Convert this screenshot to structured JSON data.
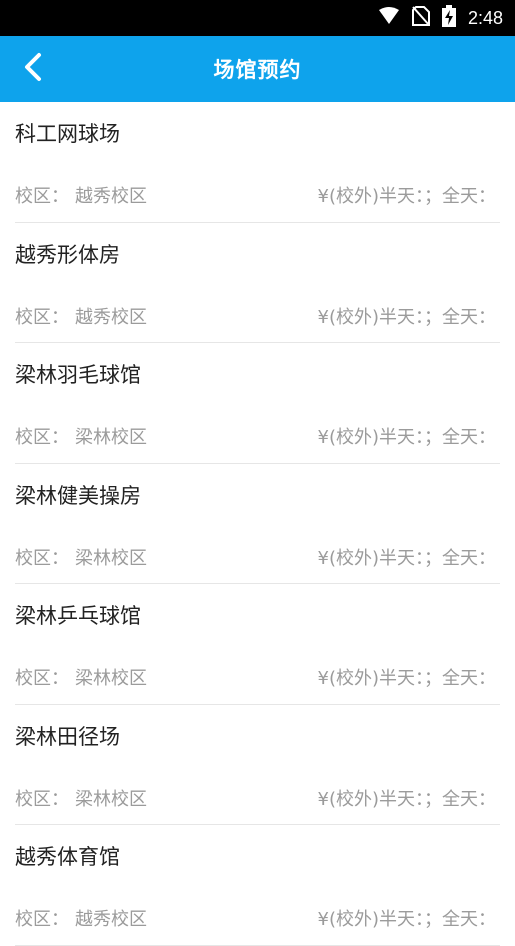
{
  "status_bar": {
    "time": "2:48",
    "icons": [
      "wifi-icon",
      "no-sim-icon",
      "battery-charging-icon"
    ]
  },
  "app_bar": {
    "title": "场馆预约",
    "back_icon": "chevron-left-icon"
  },
  "colors": {
    "accent": "#0ea3ec",
    "meta_text": "#9b9b9b",
    "name_text": "#222222"
  },
  "venues": [
    {
      "name": "科工网球场",
      "campus_label": "校区：",
      "campus": "越秀校区",
      "price": "¥(校外)半天：；全天："
    },
    {
      "name": "越秀形体房",
      "campus_label": "校区：",
      "campus": "越秀校区",
      "price": "¥(校外)半天：；全天："
    },
    {
      "name": "梁林羽毛球馆",
      "campus_label": "校区：",
      "campus": "梁林校区",
      "price": "¥(校外)半天：；全天："
    },
    {
      "name": "梁林健美操房",
      "campus_label": "校区：",
      "campus": "梁林校区",
      "price": "¥(校外)半天：；全天："
    },
    {
      "name": "梁林乒乓球馆",
      "campus_label": "校区：",
      "campus": "梁林校区",
      "price": "¥(校外)半天：；全天："
    },
    {
      "name": "梁林田径场",
      "campus_label": "校区：",
      "campus": "梁林校区",
      "price": "¥(校外)半天：；全天："
    },
    {
      "name": "越秀体育馆",
      "campus_label": "校区：",
      "campus": "越秀校区",
      "price": "¥(校外)半天：；全天："
    }
  ]
}
